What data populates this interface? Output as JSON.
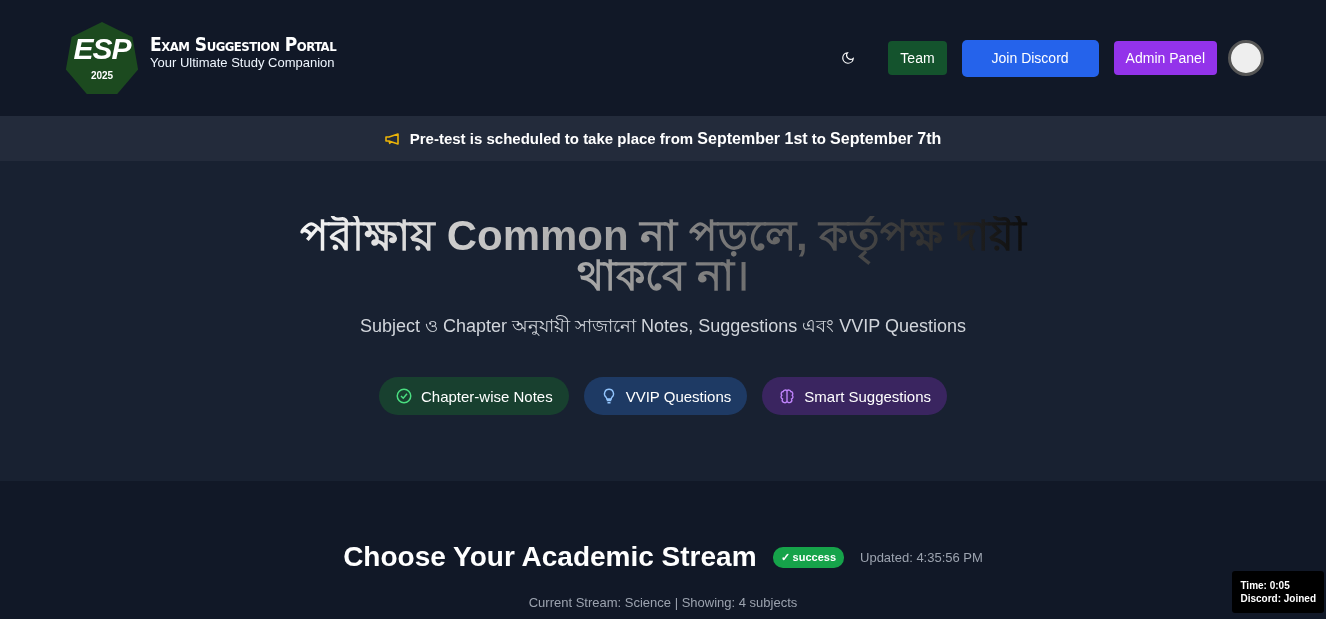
{
  "logo": {
    "initials": "ESP",
    "year": "2025"
  },
  "brand": {
    "title": "Exam Suggestion Portal",
    "subtitle": "Your Ultimate Study Companion"
  },
  "nav": {
    "buttons": [
      {
        "label": "Team",
        "kind": "team"
      },
      {
        "label": "Join Discord",
        "kind": "discord"
      },
      {
        "label": "Admin Panel",
        "kind": "admin"
      }
    ]
  },
  "announcement": "Pre-test is scheduled to take place from **September 1st** to **September 7th**",
  "hero": {
    "headline": "পরীক্ষায় Common না পড়লে, কর্তৃপক্ষ দায়ী থাকবে না।",
    "subtitle": "Subject ও Chapter অনুযায়ী সাজানো Notes, Suggestions এবং VVIP Questions",
    "features": [
      {
        "label": "Chapter-wise Notes",
        "kind": "check"
      },
      {
        "label": "VVIP Questions",
        "kind": "bulb"
      },
      {
        "label": "Smart Suggestions",
        "kind": "brain"
      }
    ]
  },
  "stream": {
    "title": "Choose Your Academic Stream",
    "status": "✓ success",
    "updated": "Updated: 4:35:56 PM",
    "info": "Current Stream: Science | Showing: 4 subjects"
  },
  "debug": {
    "time": "Time: 0:05",
    "discord": "Discord: Joined"
  }
}
